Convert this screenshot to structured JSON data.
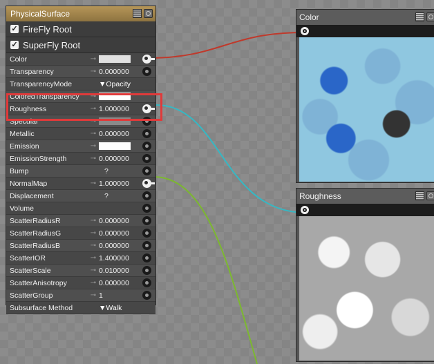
{
  "main_node": {
    "title": "PhysicalSurface",
    "roots": [
      "FireFly Root",
      "SuperFly Root"
    ],
    "properties": [
      {
        "name": "Color",
        "value": "",
        "kind": "swatch",
        "swatch": "#e0e0e0",
        "socket": "on"
      },
      {
        "name": "Transparency",
        "value": "0.000000",
        "kind": "num",
        "socket": "off"
      },
      {
        "name": "TransparencyMode",
        "value": "▼Opacity",
        "kind": "dd",
        "socket": "none"
      },
      {
        "name": "ColoredTransparency",
        "value": "",
        "kind": "swatch",
        "swatch": "#ffffff",
        "socket": "none"
      },
      {
        "name": "Roughness",
        "value": "1.000000",
        "kind": "num",
        "socket": "on"
      },
      {
        "name": "Specular",
        "value": "",
        "kind": "swatch",
        "swatch": "#8a8a8a",
        "socket": "off"
      },
      {
        "name": "Metallic",
        "value": "0.000000",
        "kind": "num",
        "socket": "off"
      },
      {
        "name": "Emission",
        "value": "",
        "kind": "swatch",
        "swatch": "#ffffff",
        "socket": "off"
      },
      {
        "name": "EmissionStrength",
        "value": "0.000000",
        "kind": "num",
        "socket": "off"
      },
      {
        "name": "Bump",
        "value": "?",
        "kind": "q",
        "socket": "off"
      },
      {
        "name": "NormalMap",
        "value": "1.000000",
        "kind": "num",
        "socket": "on"
      },
      {
        "name": "Displacement",
        "value": "?",
        "kind": "q",
        "socket": "off"
      },
      {
        "name": "Volume",
        "value": "",
        "kind": "empty",
        "socket": "off"
      },
      {
        "name": "ScatterRadiusR",
        "value": "0.000000",
        "kind": "num",
        "socket": "off"
      },
      {
        "name": "ScatterRadiusG",
        "value": "0.000000",
        "kind": "num",
        "socket": "off"
      },
      {
        "name": "ScatterRadiusB",
        "value": "0.000000",
        "kind": "num",
        "socket": "off"
      },
      {
        "name": "ScatterIOR",
        "value": "1.400000",
        "kind": "num",
        "socket": "off"
      },
      {
        "name": "ScatterScale",
        "value": "0.010000",
        "kind": "num",
        "socket": "off"
      },
      {
        "name": "ScatterAnisotropy",
        "value": "0.000000",
        "kind": "num",
        "socket": "off"
      },
      {
        "name": "ScatterGroup",
        "value": "1",
        "kind": "num",
        "socket": "off"
      },
      {
        "name": "Subsurface Method",
        "value": "▼Walk",
        "kind": "dd",
        "socket": "none"
      }
    ]
  },
  "color_node": {
    "title": "Color"
  },
  "roughness_node": {
    "title": "Roughness"
  },
  "colors": {
    "wire_color": "#c0392b",
    "wire_roughness": "#35b8c4",
    "wire_normal": "#7cb82f",
    "highlight": "#e03a3a",
    "title_bar": "#a8894f"
  }
}
